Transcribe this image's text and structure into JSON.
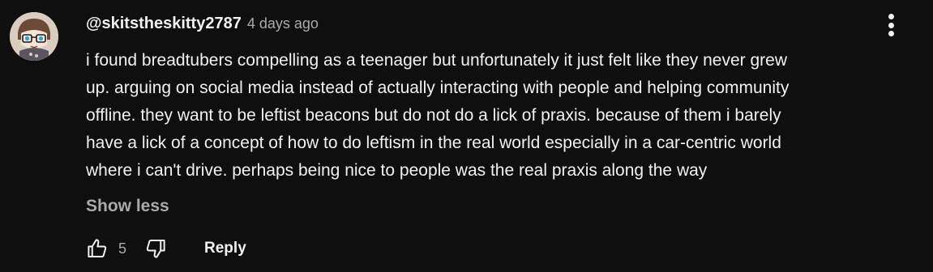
{
  "comment": {
    "author": "@skitstheskitty2787",
    "timestamp": "4 days ago",
    "text": "i found breadtubers compelling as a teenager but unfortunately it just felt like they never grew\nup. arguing on social media instead of actually interacting with people and helping community\noffline. they want to be leftist beacons but do not do a lick of praxis. because of them i barely\nhave a lick of a concept of how to do leftism in the real world especially in a car-centric world\nwhere i can't drive. perhaps being nice to people was the real praxis along the way",
    "show_less_label": "Show less",
    "like_count": "5",
    "reply_label": "Reply",
    "avatar_icon": "avatar-image",
    "menu_icon": "more-vertical-icon",
    "like_icon": "thumbs-up-icon",
    "dislike_icon": "thumbs-down-icon"
  },
  "colors": {
    "background": "#0f0f0f",
    "primary_text": "#f1f1f1",
    "secondary_text": "#aaaaaa"
  }
}
